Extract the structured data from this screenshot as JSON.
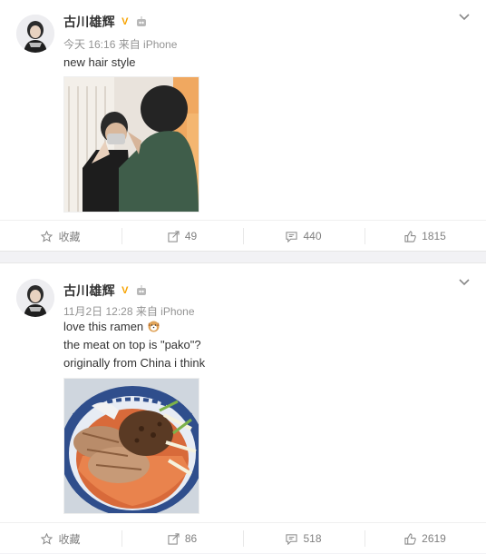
{
  "posts": [
    {
      "author": "古川雄辉",
      "vip_mark": "V",
      "meta": "今天 16:16 来自 iPhone",
      "lines": [
        "new hair style"
      ],
      "actions": {
        "favorite_label": "收藏",
        "repost": "49",
        "comment": "440",
        "like": "1815"
      }
    },
    {
      "author": "古川雄辉",
      "vip_mark": "V",
      "meta": "11月2日 12:28 来自 iPhone",
      "lines": [
        "love this ramen",
        "the meat on top is \"pako\"?",
        "originally from China i think"
      ],
      "actions": {
        "favorite_label": "收藏",
        "repost": "86",
        "comment": "518",
        "like": "2619"
      }
    }
  ],
  "colors": {
    "vip": "#f7a300",
    "muted": "#939393",
    "page_bg": "#f2f2f5"
  },
  "icons": [
    "star-icon",
    "repost-icon",
    "comment-icon",
    "like-icon",
    "chevron-down-icon",
    "robot-icon"
  ]
}
